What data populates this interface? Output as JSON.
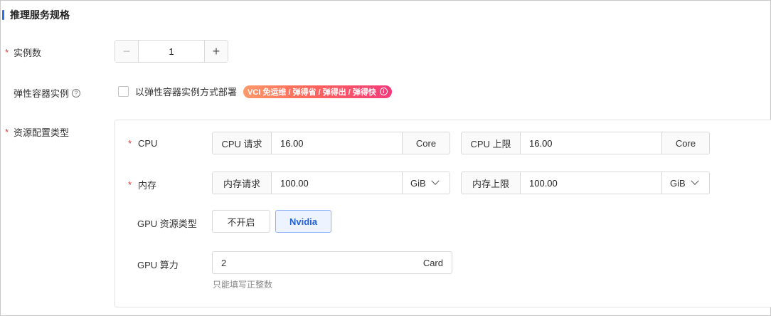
{
  "section": {
    "title": "推理服务规格"
  },
  "instances": {
    "label": "实例数",
    "required": "*",
    "minus": "−",
    "plus": "+",
    "value": "1"
  },
  "elastic": {
    "label": "弹性容器实例",
    "help": "?",
    "checkbox_label": "以弹性容器实例方式部署",
    "checked": false,
    "promo": "VCI 免运维 / 弹得省 / 弹得出 / 弹得快",
    "promo_info": "i"
  },
  "resource": {
    "label": "资源配置类型",
    "required": "*",
    "cpu": {
      "label": "CPU",
      "required": "*",
      "request_label": "CPU 请求",
      "request_value": "16.00",
      "request_unit": "Core",
      "limit_label": "CPU 上限",
      "limit_value": "16.00",
      "limit_unit": "Core"
    },
    "memory": {
      "label": "内存",
      "required": "*",
      "request_label": "内存请求",
      "request_value": "100.00",
      "request_unit": "GiB",
      "limit_label": "内存上限",
      "limit_value": "100.00",
      "limit_unit": "GiB"
    },
    "gpu_type": {
      "label": "GPU 资源类型",
      "options": [
        "不开启",
        "Nvidia"
      ],
      "selected": "Nvidia"
    },
    "gpu_power": {
      "label": "GPU 算力",
      "value": "2",
      "unit": "Card",
      "hint": "只能填写正整数"
    }
  },
  "colors": {
    "accent": "#2f6fed",
    "required": "#e23c3c",
    "active_text": "#2460d8",
    "active_bg": "#eef4ff"
  }
}
